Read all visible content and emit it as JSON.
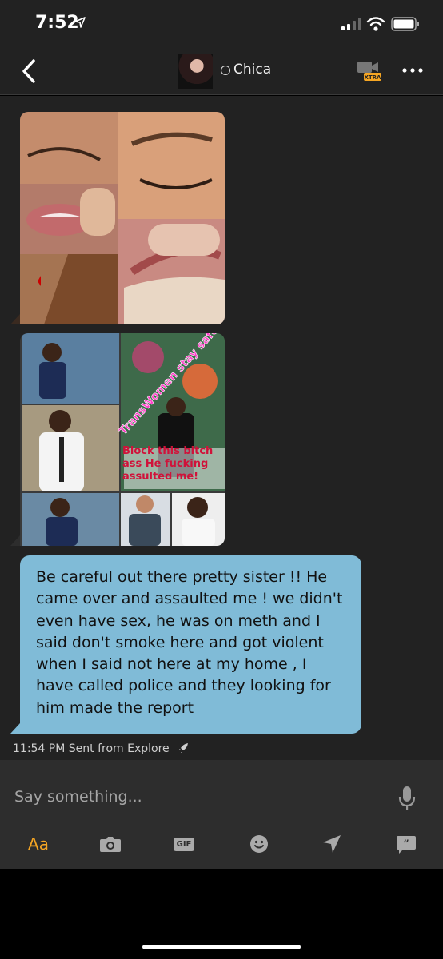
{
  "status": {
    "time": "7:52"
  },
  "header": {
    "contact_name": "Chica",
    "video_badge": "XTRA"
  },
  "messages": {
    "text": "Be careful out there pretty sister !! He came over and assaulted me ! we didn't even have sex, he was on meth and I said don't smoke here and got violent when I said not here at my home ,  I have called police and they looking for him made the report",
    "timestamp": "11:54 PM Sent from Explore",
    "image2_captions": [
      "TransWomen stay safe !!",
      "Block this bitch ass He fucking assulted me!"
    ]
  },
  "composer": {
    "placeholder": "Say something...",
    "text_tool_label": "Aa",
    "gif_label": "GIF"
  },
  "colors": {
    "bubble": "#80bbd7",
    "accent": "#f6a623",
    "background": "#222222"
  },
  "icons": [
    "location-arrow-icon",
    "signal-icon",
    "wifi-icon",
    "battery-icon",
    "back-chevron-icon",
    "video-camera-icon",
    "more-dots-icon",
    "rocket-icon",
    "microphone-icon",
    "camera-icon",
    "gif-icon",
    "emoji-icon",
    "location-icon",
    "quote-icon"
  ]
}
